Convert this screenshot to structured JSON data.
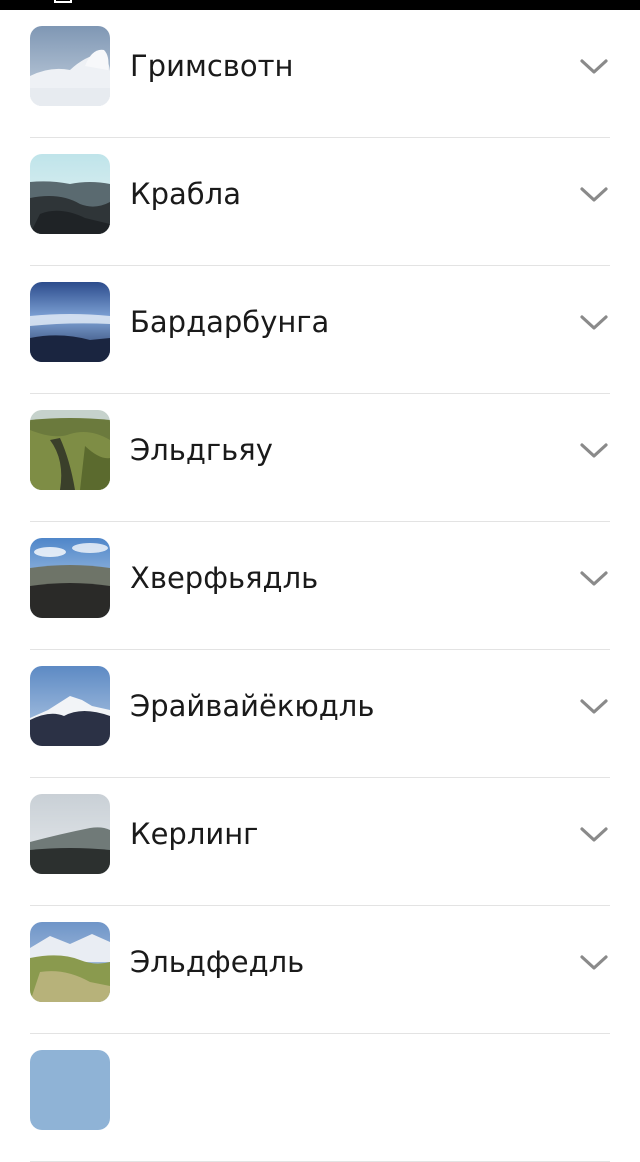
{
  "items": [
    {
      "label": "Гримсвотн",
      "icon": "chevron-down-icon"
    },
    {
      "label": "Крабла",
      "icon": "chevron-down-icon"
    },
    {
      "label": "Бардарбунга",
      "icon": "chevron-down-icon"
    },
    {
      "label": "Эльдгьяу",
      "icon": "chevron-down-icon"
    },
    {
      "label": "Хверфьядль",
      "icon": "chevron-down-icon"
    },
    {
      "label": "Эрайвайёкюдль",
      "icon": "chevron-down-icon"
    },
    {
      "label": "Керлинг",
      "icon": "chevron-down-icon"
    },
    {
      "label": "Эльдфедль",
      "icon": "chevron-down-icon"
    }
  ],
  "colors": {
    "text": "#1a1a1a",
    "chevron": "#8a8a8a",
    "divider": "#e3e3e3"
  }
}
